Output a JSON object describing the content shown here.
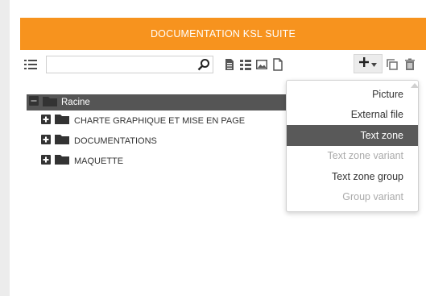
{
  "header": {
    "title": "DOCUMENTATION KSL SUITE"
  },
  "toolbar": {
    "search_value": "",
    "icons": [
      "list-icon",
      "search-icon",
      "document-icon",
      "tree-view-icon",
      "image-icon",
      "page-icon",
      "plus-icon",
      "caret-down-icon",
      "copy-icon",
      "trash-icon"
    ]
  },
  "tree": {
    "root": {
      "label": "Racine"
    },
    "items": [
      {
        "label": "CHARTE GRAPHIQUE ET MISE EN PAGE"
      },
      {
        "label": "DOCUMENTATIONS"
      },
      {
        "label": "MAQUETTE"
      }
    ]
  },
  "menu": {
    "items": [
      {
        "label": "Picture",
        "state": "normal"
      },
      {
        "label": "External file",
        "state": "normal"
      },
      {
        "label": "Text zone",
        "state": "active"
      },
      {
        "label": "Text zone variant",
        "state": "disabled"
      },
      {
        "label": "Text zone group",
        "state": "normal"
      },
      {
        "label": "Group variant",
        "state": "disabled"
      }
    ]
  },
  "colors": {
    "accent": "#f7931e",
    "selected": "#595959",
    "root": "#555555"
  }
}
